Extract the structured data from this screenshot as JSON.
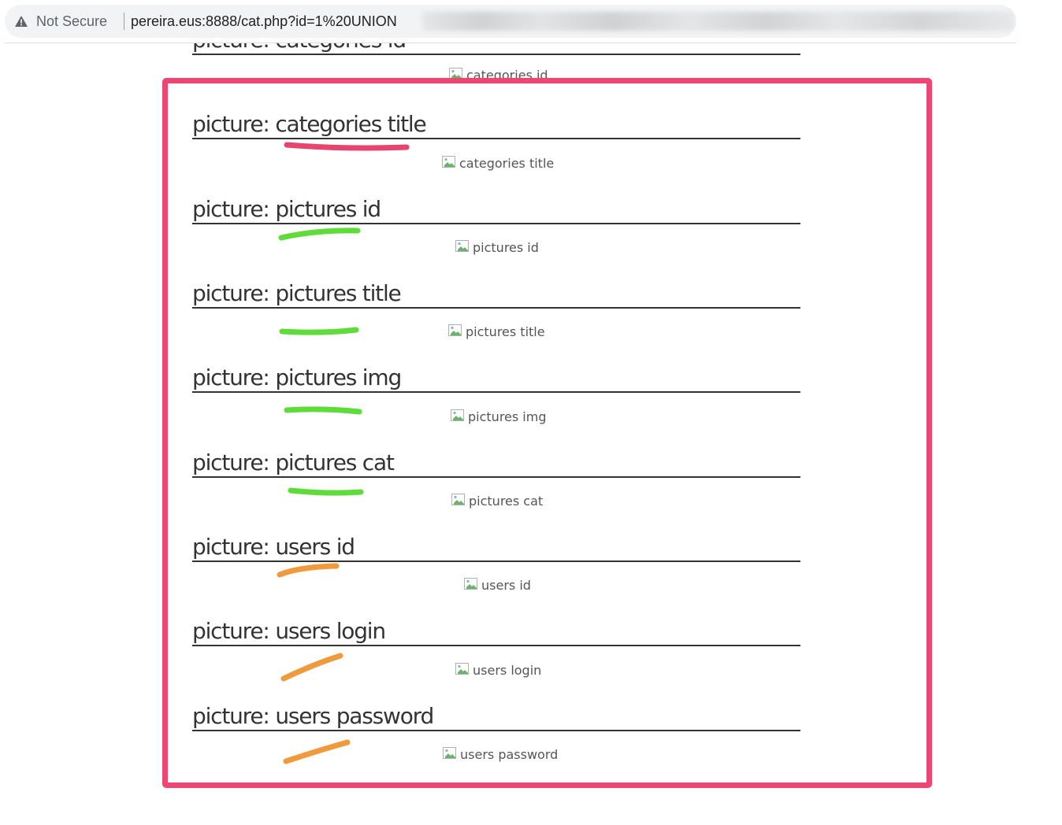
{
  "browser": {
    "security_label": "Not Secure",
    "url": "pereira.eus:8888/cat.php?id=1%20UNION",
    "icons": {
      "security": "warning-triangle-icon"
    }
  },
  "page": {
    "partial_heading": "picture: categories id",
    "partial_image_alt": "categories id",
    "rows": [
      {
        "heading": "picture: categories title",
        "alt": "categories title"
      },
      {
        "heading": "picture: pictures id",
        "alt": "pictures id"
      },
      {
        "heading": "picture: pictures title",
        "alt": "pictures title"
      },
      {
        "heading": "picture: pictures img",
        "alt": "pictures img"
      },
      {
        "heading": "picture: pictures cat",
        "alt": "pictures cat"
      },
      {
        "heading": "picture: users id",
        "alt": "users id"
      },
      {
        "heading": "picture: users login",
        "alt": "users login"
      },
      {
        "heading": "picture: users password",
        "alt": "users password"
      }
    ]
  },
  "annotations": {
    "frame_color": "#ee4572",
    "mark_colors": {
      "categories": "#e8456e",
      "pictures": "#5fdc3c",
      "users": "#ef9a3d"
    }
  }
}
